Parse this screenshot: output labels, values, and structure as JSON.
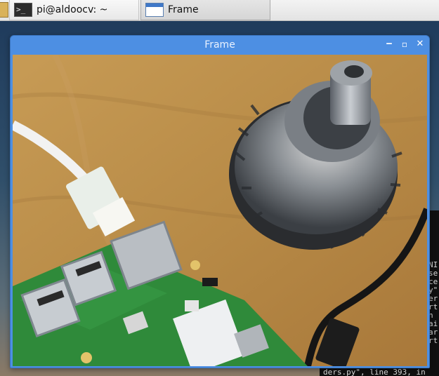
{
  "taskbar": {
    "items": [
      {
        "label": "pi@aldoocv: ~",
        "icon": "terminal-icon"
      },
      {
        "label": "Frame",
        "icon": "window-icon"
      }
    ]
  },
  "window": {
    "title": "Frame",
    "buttons": {
      "minimize": "‒",
      "maximize": "▫",
      "close": "✕"
    }
  },
  "camera_scene": {
    "objects": [
      "drill chuck",
      "white ethernet cable",
      "green circuit board",
      "black cable"
    ]
  },
  "terminal": {
    "right_edge_text": [
      "NI",
      "se",
      "",
      "ce",
      "y\"",
      "er",
      "",
      "rt",
      "n",
      "ai",
      "ar",
      "rt"
    ],
    "bottom_line": "ders.py\", line 393, in"
  },
  "colors": {
    "titlebar": "#4d8fe3",
    "wood": "#b58d4d",
    "board": "#2f8a3a"
  }
}
